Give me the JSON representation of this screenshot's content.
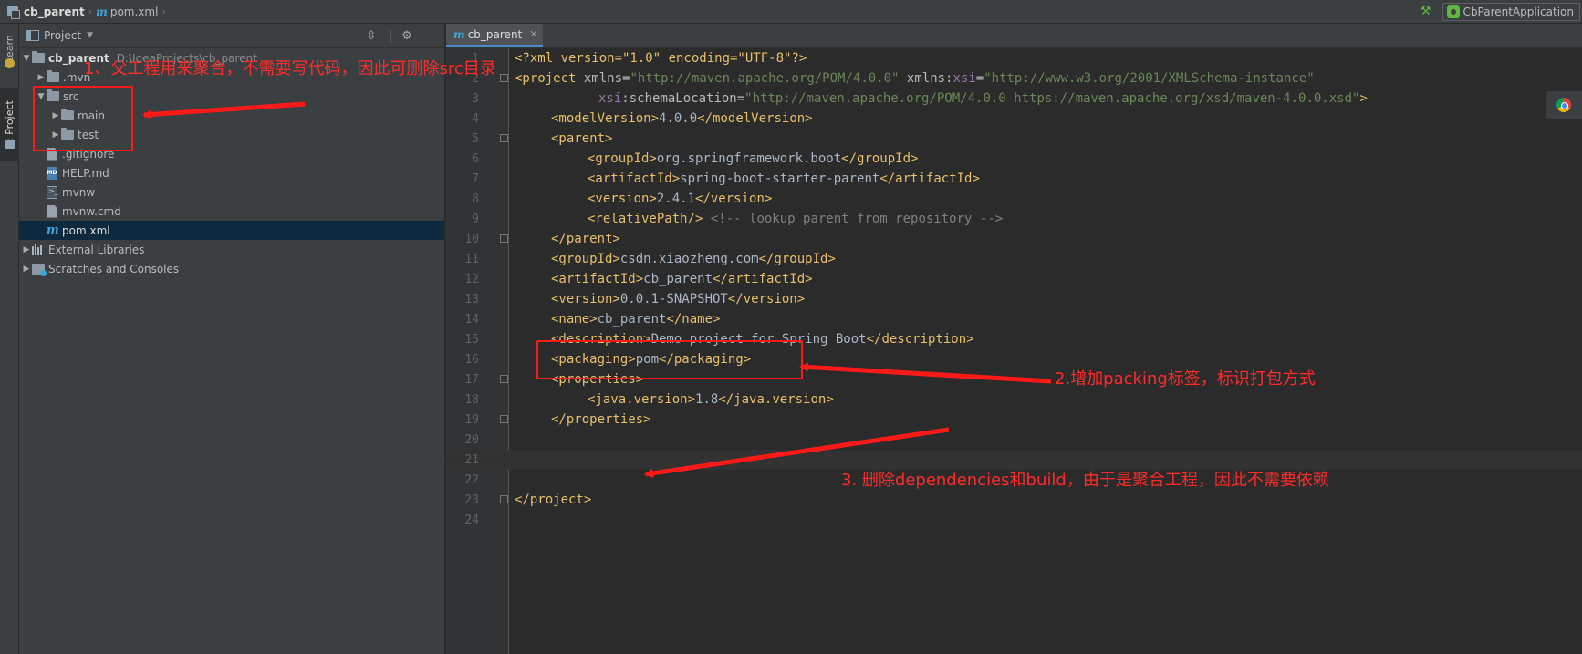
{
  "navbar": {
    "project_crumb": "cb_parent",
    "file_crumb": "pom.xml",
    "run_config": "CbParentApplication"
  },
  "toolstrip": {
    "learn_tab": "Learn",
    "project_tab": "1: Project"
  },
  "panel": {
    "title": "Project",
    "tree": [
      {
        "label": "cb_parent",
        "hint": "D:\\IdeaProjects\\cb_parent"
      },
      {
        "label": ".mvn"
      },
      {
        "label": "src"
      },
      {
        "label": "main"
      },
      {
        "label": "test"
      },
      {
        "label": ".gitignore"
      },
      {
        "label": "HELP.md"
      },
      {
        "label": "mvnw"
      },
      {
        "label": "mvnw.cmd"
      },
      {
        "label": "pom.xml"
      },
      {
        "label": "External Libraries"
      },
      {
        "label": "Scratches and Consoles"
      }
    ]
  },
  "editor": {
    "tab_label": "cb_parent",
    "line_numbers": [
      "1",
      "2",
      "3",
      "4",
      "5",
      "6",
      "7",
      "8",
      "9",
      "10",
      "11",
      "12",
      "13",
      "14",
      "15",
      "16",
      "17",
      "18",
      "19",
      "20",
      "21",
      "22",
      "23",
      "24"
    ],
    "lines": {
      "l1": "<?xml version=\"1.0\" encoding=\"UTF-8\"?>",
      "l2_open": "<project ",
      "l2_attr1": "xmlns",
      "l2_val1": "\"http://maven.apache.org/POM/4.0.0\"",
      "l2_attr2_ns": "xmlns:",
      "l2_attr2": "xsi",
      "l2_val2": "\"http://www.w3.org/2001/XMLSchema-instance\"",
      "l3_ns": "xsi",
      "l3_attr": ":schemaLocation=",
      "l3_val": "\"http://maven.apache.org/POM/4.0.0 https://maven.apache.org/xsd/maven-4.0.0.xsd\"",
      "l3_close": ">",
      "l4_open": "<modelVersion>",
      "l4_text": "4.0.0",
      "l4_close": "</modelVersion>",
      "l5": "<parent>",
      "l6_open": "<groupId>",
      "l6_text": "org.springframework.boot",
      "l6_close": "</groupId>",
      "l7_open": "<artifactId>",
      "l7_text": "spring-boot-starter-parent",
      "l7_close": "</artifactId>",
      "l8_open": "<version>",
      "l8_text": "2.4.1",
      "l8_close": "</version>",
      "l9_tag": "<relativePath/>",
      "l9_comment": " <!-- lookup parent from repository -->",
      "l10": "</parent>",
      "l11_open": "<groupId>",
      "l11_text": "csdn.xiaozheng.com",
      "l11_close": "</groupId>",
      "l12_open": "<artifactId>",
      "l12_text": "cb_parent",
      "l12_close": "</artifactId>",
      "l13_open": "<version>",
      "l13_text": "0.0.1-SNAPSHOT",
      "l13_close": "</version>",
      "l14_open": "<name>",
      "l14_text": "cb_parent",
      "l14_close": "</name>",
      "l15_open": "<description>",
      "l15_text": "Demo project for Spring Boot",
      "l15_close": "</description>",
      "l16_open": "<packaging>",
      "l16_text": "pom",
      "l16_close": "</packaging>",
      "l17": "<properties>",
      "l18_open": "<java.version>",
      "l18_text": "1.8",
      "l18_close": "</java.version>",
      "l19": "</properties>",
      "l23": "</project>"
    }
  },
  "annotations": {
    "a1": "1、父工程用来聚合，不需要写代码，因此可删除src目录",
    "a2": "2.增加packing标签，标识打包方式",
    "a3": "3. 删除dependencies和build，由于是聚合工程，因此不需要依赖"
  },
  "colors": {
    "annotation": "#ff2b2b",
    "xml_tag": "#e8bf6a",
    "xml_value": "#6a8759",
    "selection": "#0d293e"
  }
}
